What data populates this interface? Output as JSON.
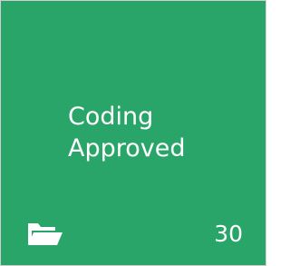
{
  "tile": {
    "title_lines": [
      "Coding",
      "Approved"
    ],
    "count": "30",
    "icon": "folder-open-icon",
    "colors": {
      "background": "#2aa56a",
      "text": "#ffffff"
    }
  }
}
